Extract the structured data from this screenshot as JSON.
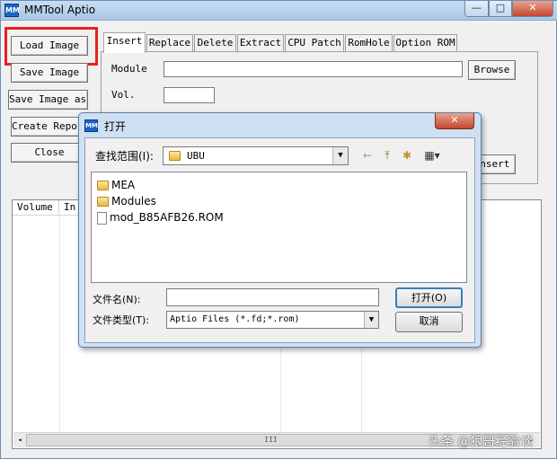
{
  "window": {
    "title": "MMTool Aptio",
    "icon_text": "MM",
    "min_glyph": "—",
    "max_glyph": "□",
    "close_glyph": "✕"
  },
  "buttons": {
    "load_image": "Load Image",
    "save_image": "Save Image",
    "save_image_as": "Save Image as..",
    "create_report": "Create Report",
    "close": "Close"
  },
  "tabs": [
    "Insert",
    "Replace",
    "Delete",
    "Extract",
    "CPU Patch",
    "RomHole",
    "Option ROM"
  ],
  "insert_panel": {
    "module_label": "Module",
    "vol_label": "Vol.",
    "browse": "Browse",
    "insert": "Insert"
  },
  "list_columns": [
    "Volume",
    "In"
  ],
  "scrollbar_thumb": "III",
  "watermark": "头条 @狼哥经验谈",
  "dialog": {
    "icon_text": "MM",
    "title": "打开",
    "close_glyph": "✕",
    "lookin_label": "查找范围(I):",
    "lookin_value": "UBU",
    "toolbar": {
      "back": "←",
      "up": "⤒",
      "new_folder": "✱",
      "views": "▦▾"
    },
    "files": [
      {
        "name": "MEA",
        "type": "folder"
      },
      {
        "name": "Modules",
        "type": "folder"
      },
      {
        "name": "mod_B85AFB26.ROM",
        "type": "file"
      }
    ],
    "filename_label": "文件名(N):",
    "filename_value": "",
    "filetype_label": "文件类型(T):",
    "filetype_value": "Aptio Files (*.fd;*.rom)",
    "open_button": "打开(O)",
    "cancel_button": "取消",
    "dropdown_glyph": "▼"
  }
}
